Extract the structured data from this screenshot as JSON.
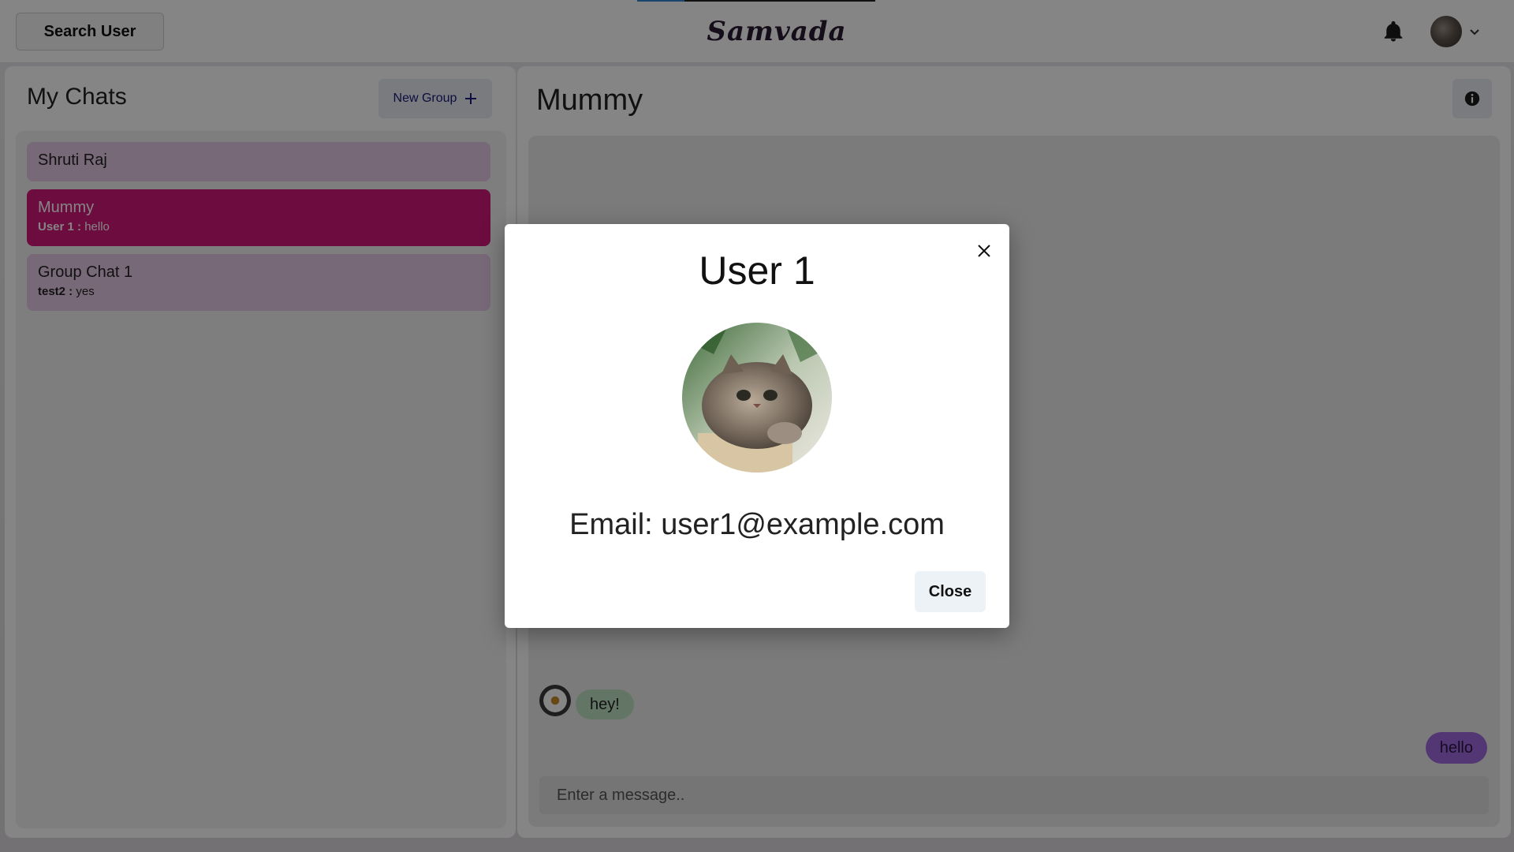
{
  "header": {
    "search_button_label": "Search User",
    "brand_name": "Samvada",
    "icons": [
      "bell-icon",
      "user-avatar",
      "chevron-down-icon"
    ]
  },
  "sidebar": {
    "title": "My Chats",
    "new_group_label": "New Group",
    "new_group_icon": "plus-icon",
    "chats": [
      {
        "name": "Shruti Raj",
        "sender": "",
        "preview": ""
      },
      {
        "name": "Mummy",
        "sender": "User 1 :",
        "preview": "hello",
        "active": true
      },
      {
        "name": "Group Chat 1",
        "sender": "test2 :",
        "preview": "yes"
      }
    ]
  },
  "chat": {
    "title": "Mummy",
    "info_icon": "info-icon",
    "messages": [
      {
        "text": "hey!",
        "direction": "incoming"
      },
      {
        "text": "hello",
        "direction": "outgoing"
      }
    ],
    "input_placeholder": "Enter a message.."
  },
  "modal": {
    "title": "User 1",
    "email_text": "Email: user1@example.com",
    "close_button_label": "Close",
    "close_icon": "close-icon",
    "photo": "cat-profile-photo"
  },
  "colors": {
    "active_chat": "#d1197a",
    "chat_item": "#e7c9e6",
    "incoming_bubble": "#bee3c4",
    "outgoing_bubble": "#9f6ae0"
  }
}
